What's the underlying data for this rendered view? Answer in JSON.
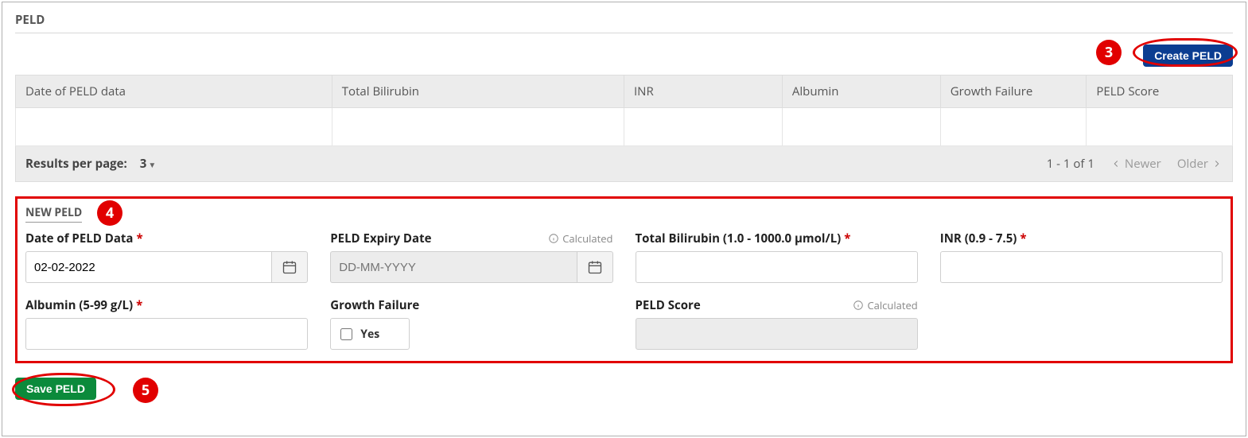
{
  "section_title": "PELD",
  "toolbar": {
    "create_label": "Create PELD"
  },
  "annotations": {
    "n3": "3",
    "n4": "4",
    "n5": "5"
  },
  "table": {
    "headers": [
      "Date of PELD data",
      "Total Bilirubin",
      "INR",
      "Albumin",
      "Growth Failure",
      "PELD Score"
    ],
    "footer": {
      "rpp_label": "Results per page:",
      "rpp_value": "3",
      "range": "1 - 1 of 1",
      "newer": "Newer",
      "older": "Older"
    }
  },
  "form": {
    "title": "NEW PELD",
    "calculated_tag": "Calculated",
    "fields": {
      "date_of_peld": {
        "label": "Date of PELD Data",
        "value": "02-02-2022"
      },
      "expiry": {
        "label": "PELD Expiry Date",
        "placeholder": "DD-MM-YYYY"
      },
      "bilirubin": {
        "label": "Total Bilirubin (1.0 - 1000.0 µmol/L)"
      },
      "inr": {
        "label": "INR (0.9 - 7.5)"
      },
      "albumin": {
        "label": "Albumin (5-99 g/L)"
      },
      "growth": {
        "label": "Growth Failure",
        "option": "Yes"
      },
      "score": {
        "label": "PELD Score"
      }
    }
  },
  "save": {
    "label": "Save PELD"
  }
}
